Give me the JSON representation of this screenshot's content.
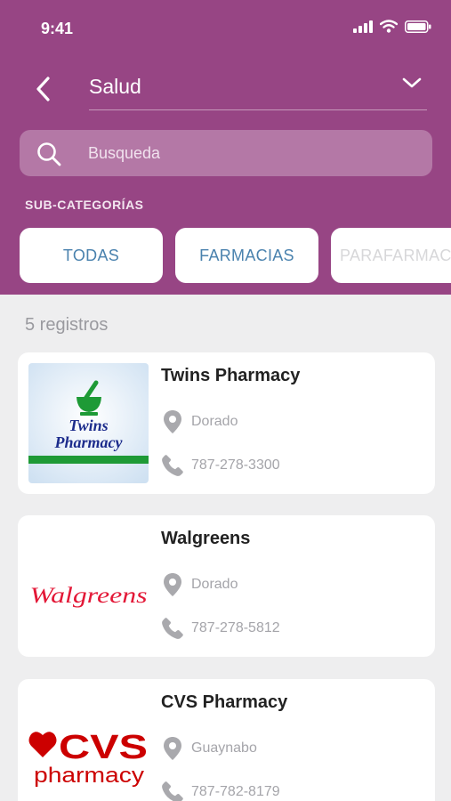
{
  "status_bar": {
    "time": "9:41"
  },
  "header": {
    "category": "Salud",
    "search_placeholder": "Busqueda",
    "subcategories_title": "SUB-CATEGORÍAS",
    "subcategories": [
      "TODAS",
      "FARMACIAS",
      "PARAFARMACIAS"
    ]
  },
  "results": {
    "count_label": "5 registros",
    "items": [
      {
        "name": "Twins Pharmacy",
        "city": "Dorado",
        "phone": "787-278-3300",
        "logo_text": [
          "Twins",
          "Pharmacy"
        ]
      },
      {
        "name": "Walgreens",
        "city": "Dorado",
        "phone": "787-278-5812",
        "logo_text": [
          "Walgreens"
        ]
      },
      {
        "name": "CVS Pharmacy",
        "city": "Guaynabo",
        "phone": "787-782-8179",
        "logo_text": [
          "CVS",
          "pharmacy"
        ]
      }
    ]
  },
  "colors": {
    "header_bg": "#974584",
    "chip_text": "#4a82ae",
    "walgreens_red": "#e31837",
    "cvs_red": "#cc0000",
    "twins_blue": "#1c2c8c",
    "twins_green": "#1e9a36"
  },
  "icons": [
    "back-chevron",
    "dropdown-chevron",
    "search",
    "location-pin",
    "phone",
    "signal",
    "wifi",
    "battery"
  ]
}
